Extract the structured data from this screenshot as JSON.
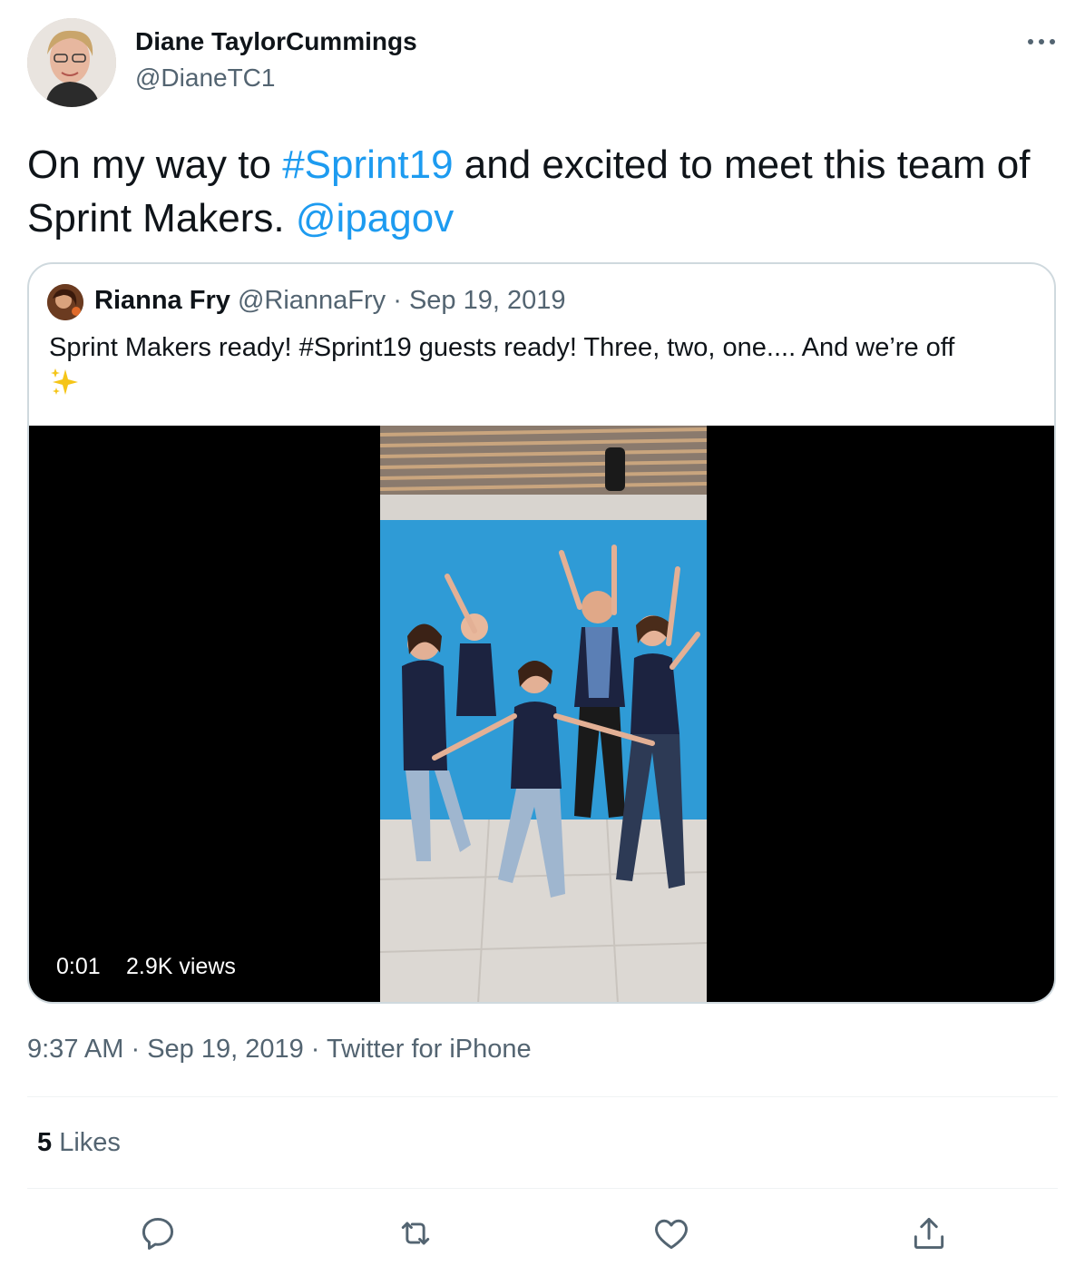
{
  "author": {
    "name": "Diane TaylorCummings",
    "handle": "@DianeTC1"
  },
  "tweet": {
    "text_part1": "On my way to ",
    "hashtag": "#Sprint19",
    "text_part2": " and excited to meet this team of Sprint Makers. ",
    "mention": "@ipagov"
  },
  "quoted": {
    "name": "Rianna Fry",
    "handle": "@RiannaFry",
    "separator": " · ",
    "date": "Sep 19, 2019",
    "text": "Sprint Makers ready! #Sprint19 guests ready! Three, two, one.... And we’re off",
    "emoji": "sparkles-emoji",
    "video": {
      "time": "0:01",
      "views": "2.9K views"
    }
  },
  "meta": {
    "time": "9:37 AM",
    "sep": " · ",
    "date": "Sep 19, 2019",
    "source": "Twitter for iPhone"
  },
  "likes": {
    "count": "5",
    "label": " Likes"
  },
  "actions": {
    "reply_icon": "reply-icon",
    "retweet_icon": "retweet-icon",
    "like_icon": "heart-icon",
    "share_icon": "share-icon"
  },
  "colors": {
    "link": "#1d9bf0",
    "secondary_text": "#536471",
    "primary_text": "#0f1419",
    "backdrop_blue": "#2f9bd6"
  }
}
